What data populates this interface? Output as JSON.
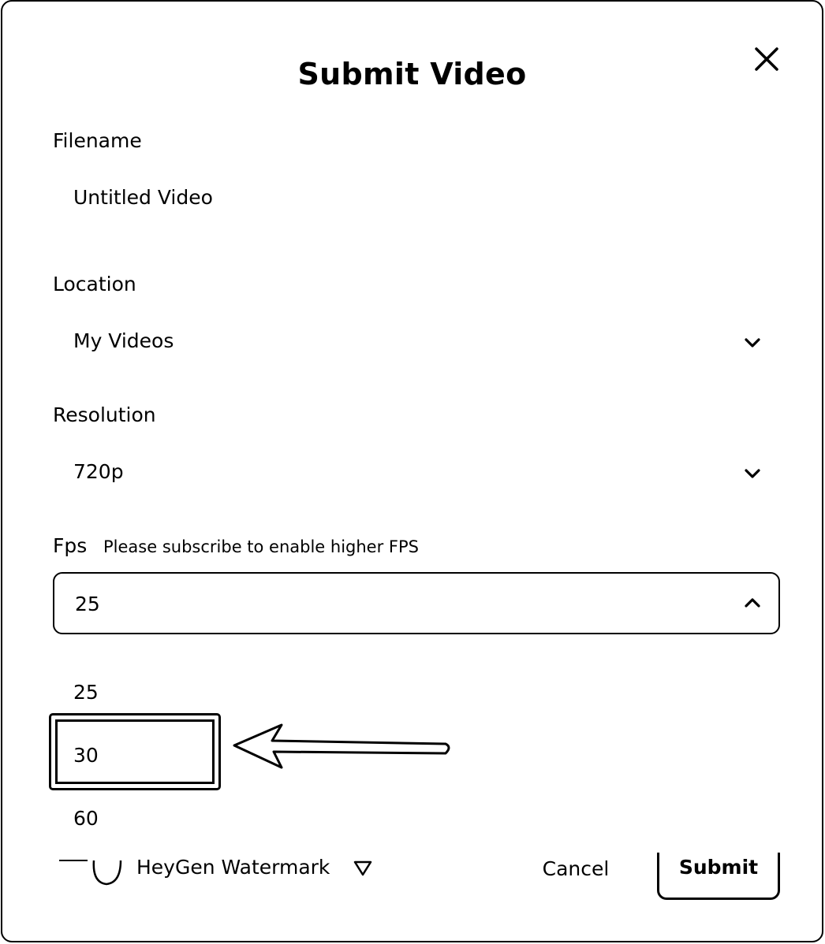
{
  "dialog": {
    "title": "Submit Video"
  },
  "filename": {
    "label": "Filename",
    "value": "Untitled Video"
  },
  "location": {
    "label": "Location",
    "value": "My Videos"
  },
  "resolution": {
    "label": "Resolution",
    "value": "720p"
  },
  "fps": {
    "label": "Fps",
    "note": "Please subscribe to enable higher FPS",
    "selected": "25",
    "options": [
      "25",
      "30",
      "60"
    ]
  },
  "footer": {
    "watermark_label": "HeyGen Watermark",
    "cancel_label": "Cancel",
    "submit_label": "Submit"
  },
  "icons": {
    "close": "close-icon",
    "chevron_down": "chevron-down-icon",
    "chevron_up": "chevron-up-icon",
    "info": "info-icon",
    "toggle": "toggle-switch",
    "annotation_arrow": "arrow-left-icon"
  }
}
